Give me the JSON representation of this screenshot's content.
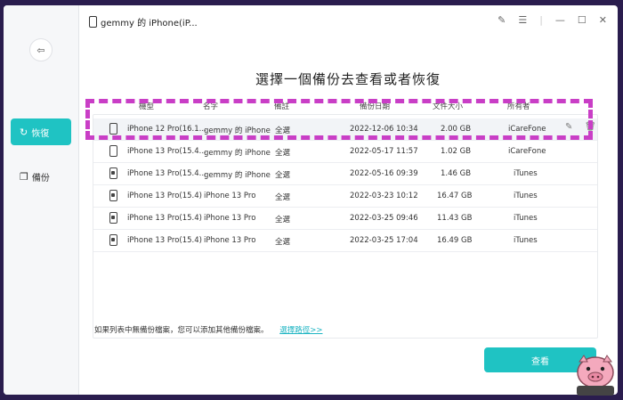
{
  "window": {
    "device_title": "gemmy 的 iPhone(iP..."
  },
  "sidebar": {
    "items": [
      {
        "label": "恢復",
        "icon": "refresh-icon"
      },
      {
        "label": "備份",
        "icon": "copy-icon"
      }
    ]
  },
  "main": {
    "title": "選擇一個備份去查看或者恢復",
    "columns": [
      "機型",
      "名字",
      "備註",
      "備份日期",
      "文件大小",
      "所有者"
    ],
    "rows": [
      {
        "model": "iPhone 12 Pro(16.1...",
        "name": "gemmy 的 iPhone",
        "note": "全選",
        "date": "2022-12-06 10:34",
        "size": "2.00 GB",
        "owner": "iCareFone"
      },
      {
        "model": "iPhone 13 Pro(15.4...",
        "name": "gemmy 的 iPhone",
        "note": "全選",
        "date": "2022-05-17 11:57",
        "size": "1.02 GB",
        "owner": "iCareFone"
      },
      {
        "model": "iPhone 13 Pro(15.4...",
        "name": "gemmy 的 iPhone",
        "note": "全選",
        "date": "2022-05-16 09:39",
        "size": "1.46 GB",
        "owner": "iTunes"
      },
      {
        "model": "iPhone 13 Pro(15.4)",
        "name": "iPhone 13 Pro",
        "note": "全選",
        "date": "2022-03-23 10:12",
        "size": "16.47 GB",
        "owner": "iTunes"
      },
      {
        "model": "iPhone 13 Pro(15.4)",
        "name": "iPhone 13 Pro",
        "note": "全選",
        "date": "2022-03-25 09:46",
        "size": "11.43 GB",
        "owner": "iTunes"
      },
      {
        "model": "iPhone 13 Pro(15.4)",
        "name": "iPhone 13 Pro",
        "note": "全選",
        "date": "2022-03-25 17:04",
        "size": "16.49 GB",
        "owner": "iTunes"
      }
    ]
  },
  "footer": {
    "hint": "如果列表中無備份檔案，您可以添加其他備份檔案。",
    "link": "選擇路徑>>",
    "confirm_label": "查看"
  },
  "colors": {
    "accent": "#1fc3c3",
    "highlight": "#c93ec6"
  }
}
